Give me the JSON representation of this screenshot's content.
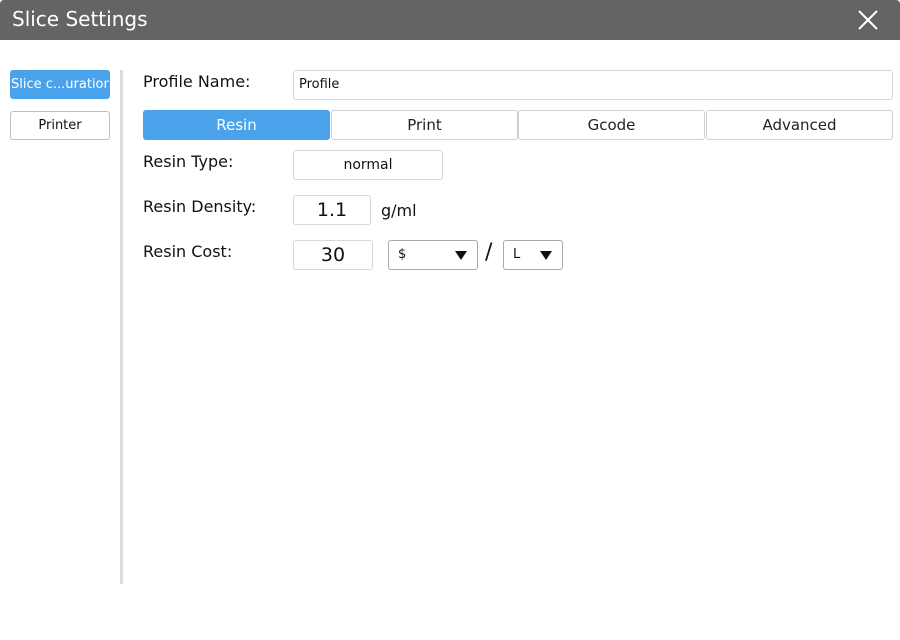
{
  "window": {
    "title": "Slice Settings"
  },
  "sidebar": {
    "items": [
      {
        "label": "Slice c...uration",
        "active": true
      },
      {
        "label": "Printer",
        "active": false
      }
    ]
  },
  "profile": {
    "label": "Profile Name:",
    "value": "Profile"
  },
  "tabs": [
    {
      "label": "Resin",
      "active": true
    },
    {
      "label": "Print",
      "active": false
    },
    {
      "label": "Gcode",
      "active": false
    },
    {
      "label": "Advanced",
      "active": false
    }
  ],
  "resin": {
    "type_label": "Resin Type:",
    "type_value": "normal",
    "density_label": "Resin Density:",
    "density_value": "1.1",
    "density_unit": "g/ml",
    "cost_label": "Resin Cost:",
    "cost_value": "30",
    "currency": "$",
    "separator": "/",
    "volume_unit": "L"
  },
  "colors": {
    "accent": "#4aa3ea",
    "titlebar": "#646464"
  }
}
